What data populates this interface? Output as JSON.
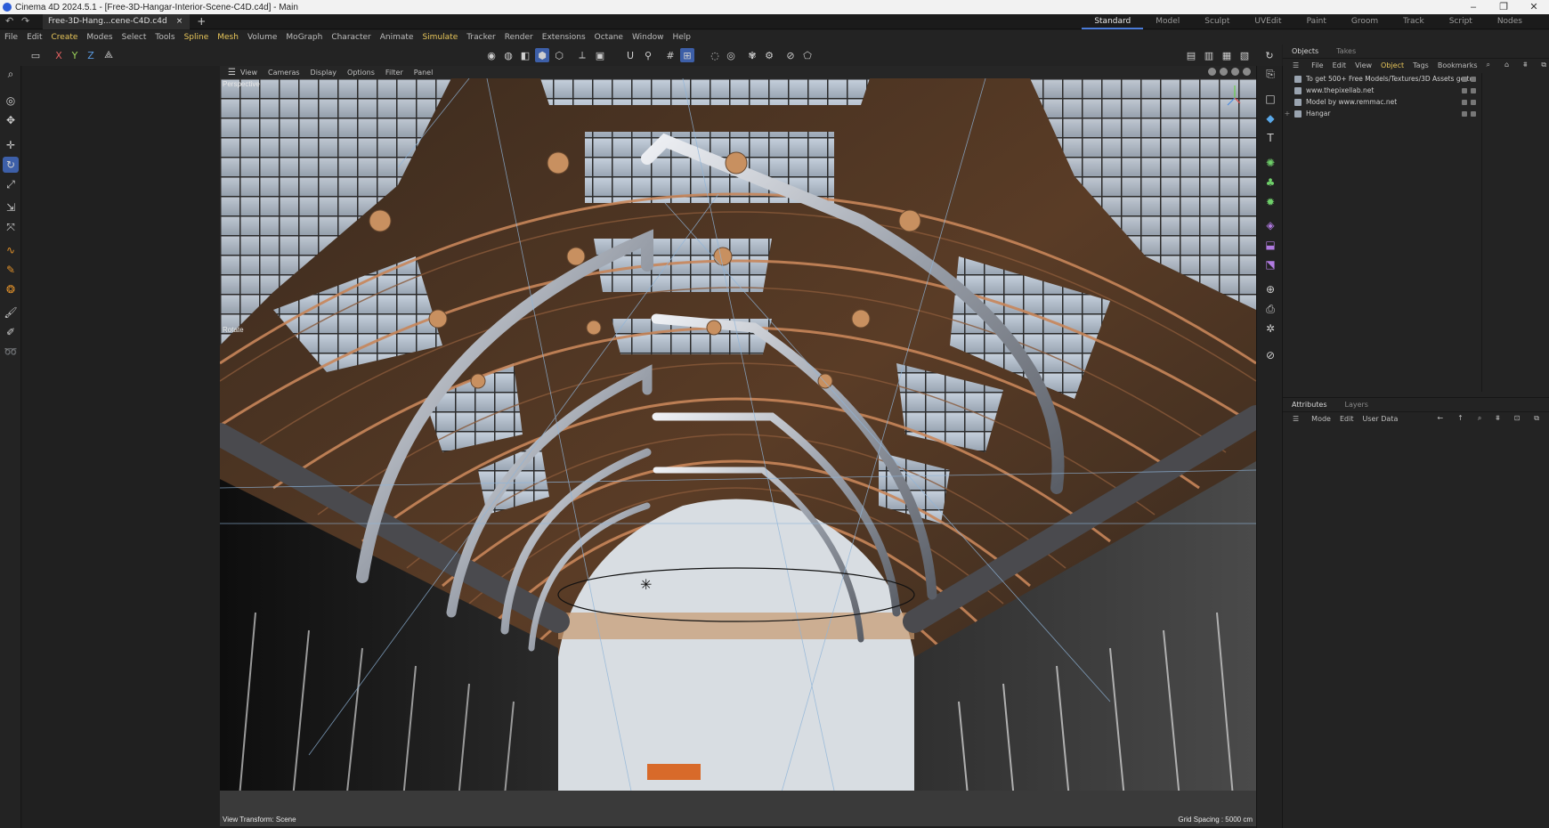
{
  "window": {
    "title": "Cinema 4D 2024.5.1 - [Free-3D-Hangar-Interior-Scene-C4D.c4d] - Main",
    "controls": [
      "–",
      "❐",
      "✕"
    ]
  },
  "document_tab": {
    "label": "Free-3D-Hang...cene-C4D.c4d",
    "close": "×",
    "add": "+"
  },
  "layouts": [
    "Standard",
    "Model",
    "Sculpt",
    "UVEdit",
    "Paint",
    "Groom",
    "Track",
    "Script",
    "Nodes"
  ],
  "active_layout": "Standard",
  "menu": [
    "File",
    "Edit",
    "Create",
    "Modes",
    "Select",
    "Tools",
    "Spline",
    "Mesh",
    "Volume",
    "MoGraph",
    "Character",
    "Animate",
    "Simulate",
    "Tracker",
    "Render",
    "Extensions",
    "Octane",
    "Window",
    "Help"
  ],
  "highlighted_menus": [
    "Create",
    "Spline",
    "Mesh",
    "Simulate"
  ],
  "toolbar": {
    "axis_x": "X",
    "axis_y": "Y",
    "axis_z": "Z"
  },
  "viewport": {
    "menu": [
      "View",
      "Cameras",
      "Display",
      "Options",
      "Filter",
      "Panel"
    ],
    "camera_label": "Perspective",
    "mode_label": "Rotate",
    "view_transform": "View Transform: Scene",
    "grid_spacing": "Grid Spacing : 5000 cm"
  },
  "objects_panel": {
    "tabs": [
      "Objects",
      "Takes"
    ],
    "menu": [
      "File",
      "Edit",
      "View",
      "Object",
      "Tags",
      "Bookmarks"
    ],
    "highlighted_menu": "Object",
    "rows": [
      {
        "label": "To get 500+ Free Models/Textures/3D Assets go to:",
        "expander": ""
      },
      {
        "label": "www.thepixellab.net",
        "expander": ""
      },
      {
        "label": "Model by www.remmac.net",
        "expander": ""
      },
      {
        "label": "Hangar",
        "expander": "+"
      }
    ]
  },
  "attributes_panel": {
    "tabs": [
      "Attributes",
      "Layers"
    ],
    "menu": [
      "Mode",
      "Edit",
      "User Data"
    ]
  },
  "colors": {
    "accent": "#3d5fa8",
    "menu_highlight": "#e8c65a",
    "panel_bg": "#232323"
  }
}
